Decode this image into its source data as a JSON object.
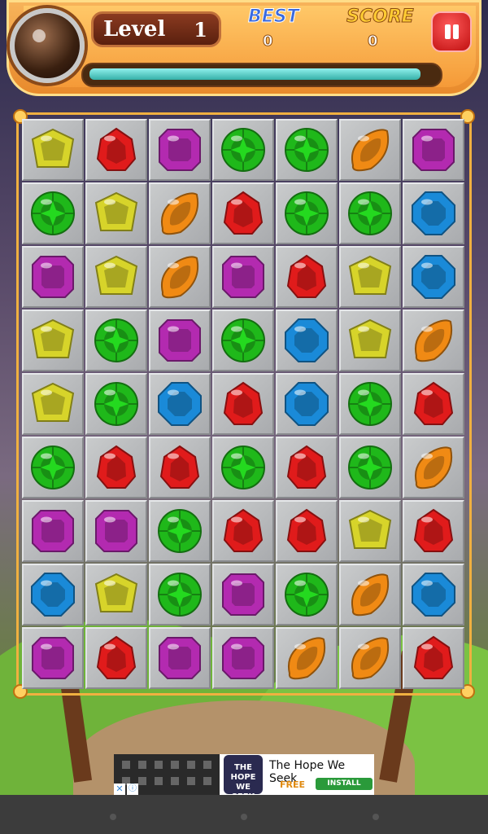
{
  "hud": {
    "level_label": "Level",
    "level_value": "1",
    "best_label": "BEST",
    "best_value": "0",
    "score_label": "SCORE",
    "score_value": "0",
    "progress_fraction": 0.96
  },
  "colors": {
    "yellow": "#d7d42a",
    "red": "#e01b1b",
    "purple": "#b32ab0",
    "green": "#1fb81a",
    "orange": "#f08a14",
    "blue": "#1a8ad8"
  },
  "gem_icons": {
    "Y": "yellow-pentagon-gem-icon",
    "R": "red-drop-gem-icon",
    "P": "purple-square-gem-icon",
    "G": "green-round-gem-icon",
    "O": "orange-leaf-gem-icon",
    "B": "blue-octagon-gem-icon"
  },
  "board": [
    [
      "Y",
      "R",
      "P",
      "G",
      "G",
      "O",
      "P"
    ],
    [
      "G",
      "Y",
      "O",
      "R",
      "G",
      "G",
      "B"
    ],
    [
      "P",
      "Y",
      "O",
      "P",
      "R",
      "Y",
      "B"
    ],
    [
      "Y",
      "G",
      "P",
      "G",
      "B",
      "Y",
      "O"
    ],
    [
      "Y",
      "G",
      "B",
      "R",
      "B",
      "G",
      "R"
    ],
    [
      "G",
      "R",
      "R",
      "G",
      "R",
      "G",
      "O"
    ],
    [
      "P",
      "P",
      "G",
      "R",
      "R",
      "Y",
      "R"
    ],
    [
      "B",
      "Y",
      "G",
      "P",
      "G",
      "O",
      "B"
    ],
    [
      "P",
      "R",
      "P",
      "P",
      "O",
      "O",
      "R"
    ]
  ],
  "ad": {
    "title": "The Hope We Seek",
    "book_text": "THE HOPE WE SEEK",
    "free_label": "FREE",
    "install_label": "INSTALL"
  }
}
